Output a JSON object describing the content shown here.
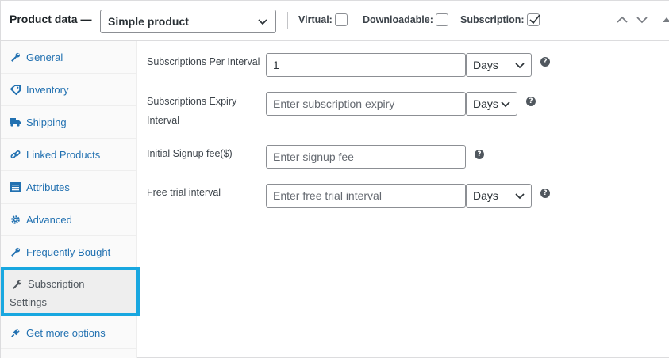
{
  "header": {
    "title": "Product data —",
    "product_type": "Simple product",
    "options": [
      {
        "label": "Virtual:",
        "checked": false
      },
      {
        "label": "Downloadable:",
        "checked": false
      },
      {
        "label": "Subscription:",
        "checked": true
      }
    ]
  },
  "sidebar": {
    "items": [
      {
        "label": "General",
        "icon": "wrench-icon"
      },
      {
        "label": "Inventory",
        "icon": "tag-icon"
      },
      {
        "label": "Shipping",
        "icon": "truck-icon"
      },
      {
        "label": "Linked Products",
        "icon": "link-icon"
      },
      {
        "label": "Attributes",
        "icon": "list-icon"
      },
      {
        "label": "Advanced",
        "icon": "gear-icon"
      },
      {
        "label": "Frequently Bought",
        "icon": "wrench-icon"
      },
      {
        "label_line1": "Subscription",
        "label_line2": "Settings",
        "icon": "wrench-icon",
        "active": true
      },
      {
        "label": "Get more options",
        "icon": "plugin-icon"
      }
    ]
  },
  "form": {
    "per_interval": {
      "label": "Subscriptions Per Interval",
      "value": "1",
      "unit": "Days"
    },
    "expiry": {
      "label_line1": "Subscriptions Expiry",
      "label_line2": "Interval",
      "placeholder": "Enter subscription expiry",
      "unit": "Days"
    },
    "signup_fee": {
      "label": "Initial Signup fee($)",
      "placeholder": "Enter signup fee"
    },
    "free_trial": {
      "label": "Free trial interval",
      "placeholder": "Enter free trial interval",
      "unit": "Days"
    },
    "help_glyph": "?"
  },
  "colors": {
    "link": "#2271b1",
    "active_border": "#18a7e0"
  }
}
